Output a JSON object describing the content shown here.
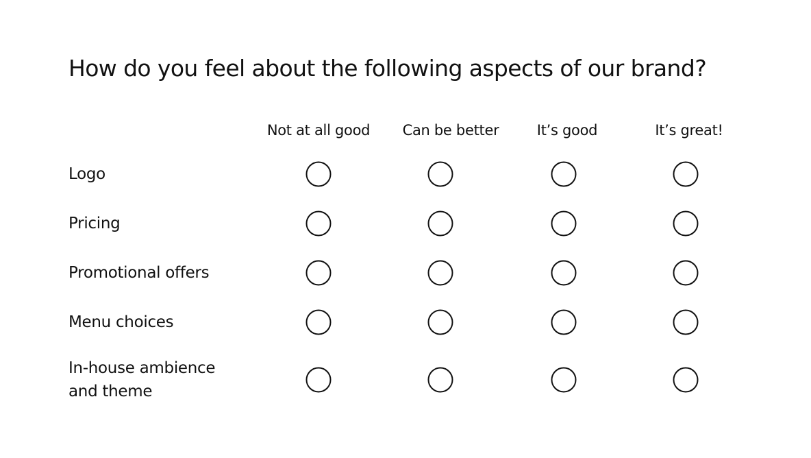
{
  "question": {
    "title": "How do you feel about the following aspects of our brand?"
  },
  "columns": [
    {
      "label": "Not at all good"
    },
    {
      "label": "Can be better"
    },
    {
      "label": "It’s good"
    },
    {
      "label": "It’s great!"
    }
  ],
  "rows": [
    {
      "label": "Logo",
      "selected": null
    },
    {
      "label": "Pricing",
      "selected": null
    },
    {
      "label": "Promotional offers",
      "selected": null
    },
    {
      "label": "Menu choices",
      "selected": null
    },
    {
      "label": "In-house ambience and theme",
      "selected": null
    }
  ],
  "radio_icon": "empty-circle-radio"
}
